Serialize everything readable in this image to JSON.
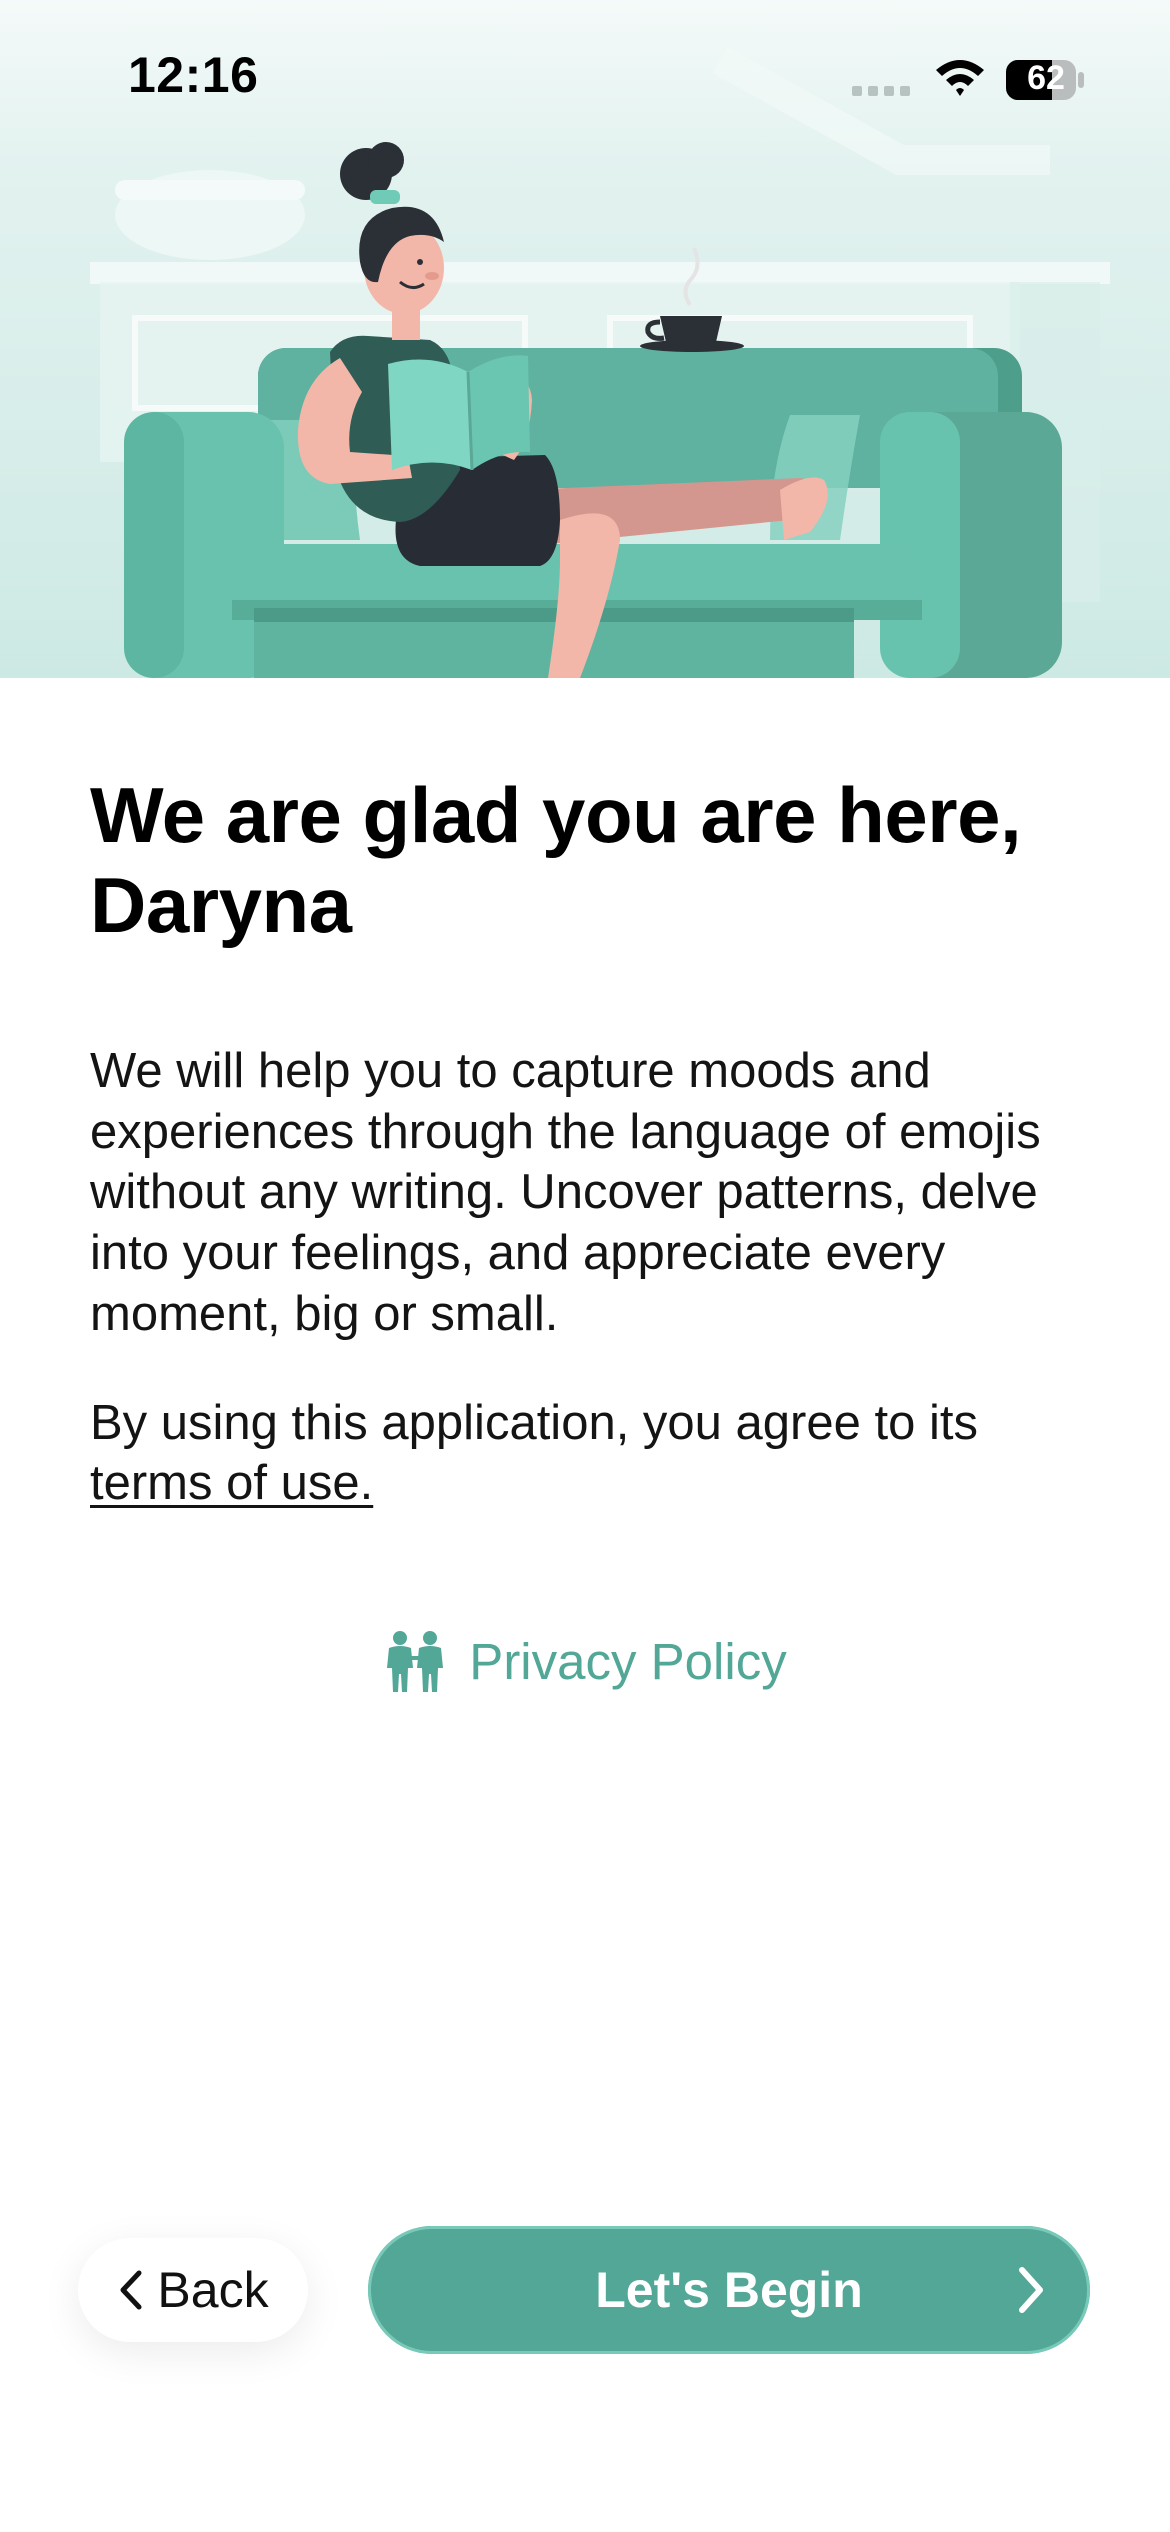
{
  "status_bar": {
    "time": "12:16",
    "battery": "62",
    "icons": [
      "cellular-signal-icon",
      "wifi-icon",
      "battery-icon"
    ]
  },
  "hero": {
    "illustration": "woman-reading-book-on-sofa-illustration"
  },
  "main": {
    "headline": "We are glad you are here, Daryna",
    "body": "We will help you to capture moods and experiences through the language of emojis without any writing. Uncover patterns, delve into your feelings, and appreciate every moment, big or small.",
    "terms_prefix": "By using this application, you agree to its ",
    "terms_link": "terms of use.",
    "privacy_label": "Privacy Policy",
    "privacy_icon": "two-people-icon"
  },
  "footer": {
    "back_label": "Back",
    "begin_label": "Let's Begin"
  },
  "colors": {
    "accent": "#52a797",
    "sofa": "#5fb5a2",
    "hero_background": "#d3ece8"
  }
}
